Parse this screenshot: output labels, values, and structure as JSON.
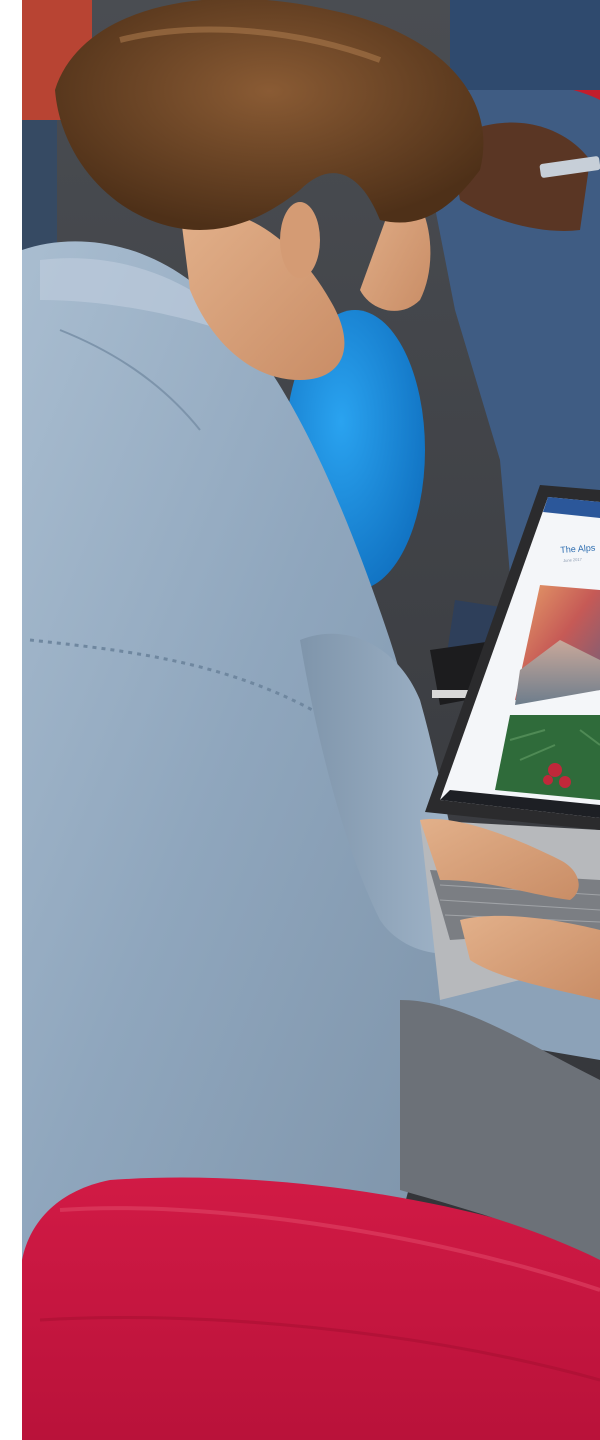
{
  "photo": {
    "subject": "photo",
    "laptop_screen": {
      "document_title": "The Alps",
      "document_subtitle": "June 2017"
    }
  }
}
